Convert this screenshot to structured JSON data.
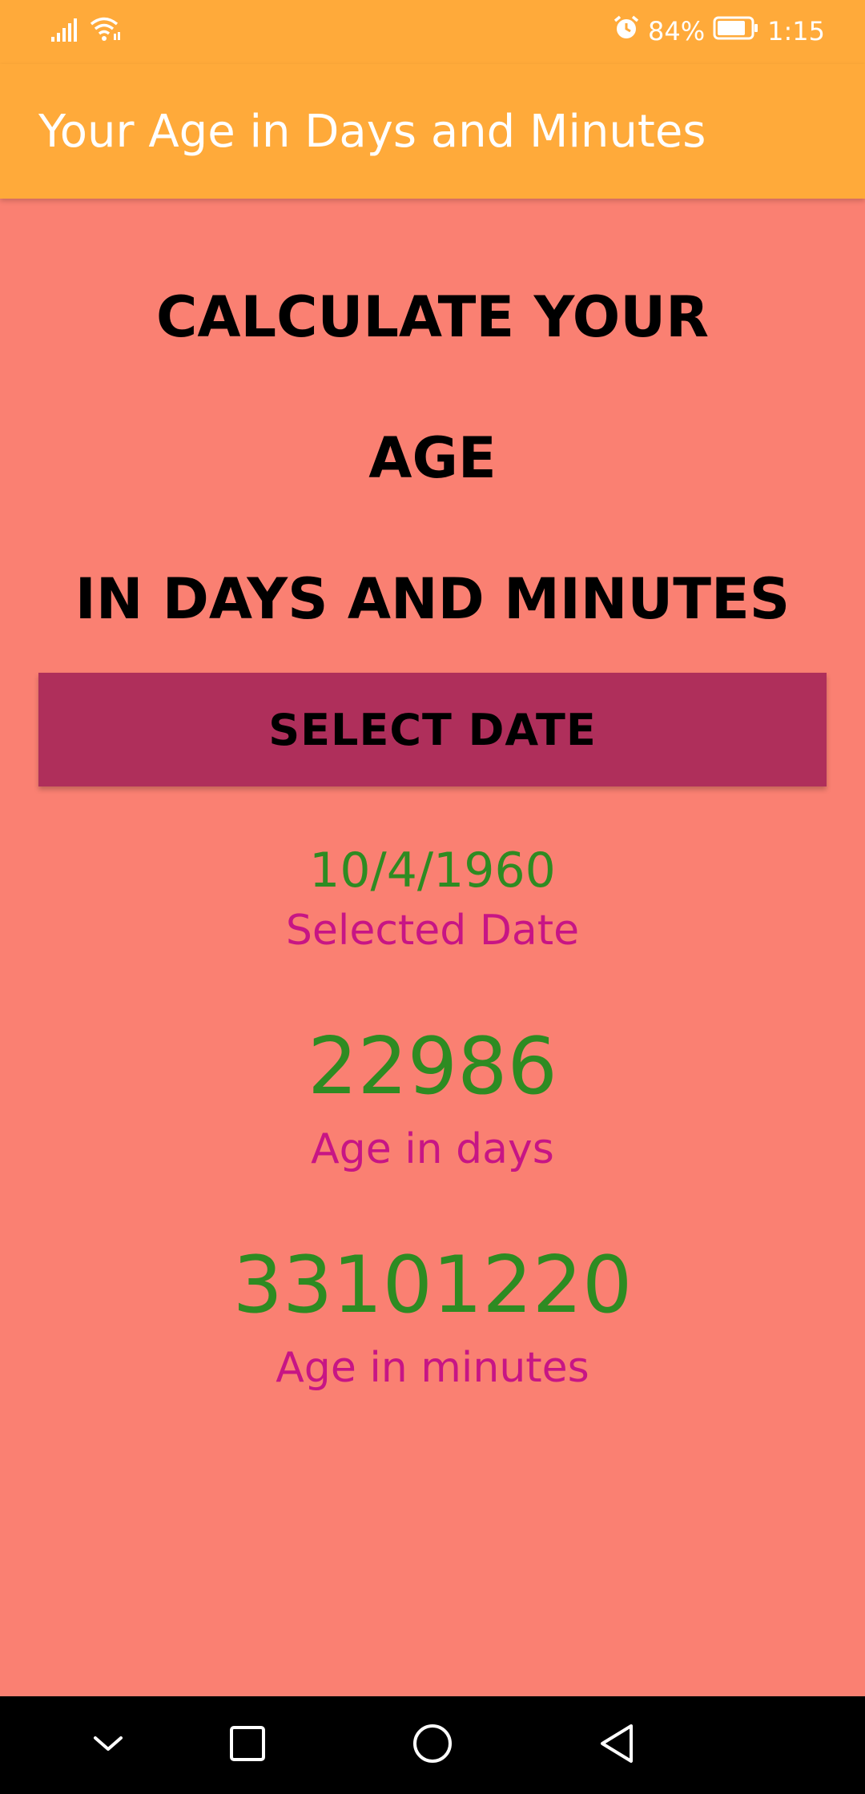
{
  "status_bar": {
    "battery": "84%",
    "time": "1:15",
    "icons": [
      "signal-icon",
      "wifi-icon",
      "alarm-icon",
      "battery-icon"
    ]
  },
  "app_bar": {
    "title": "Your Age in Days and Minutes"
  },
  "main": {
    "heading_line1": "CALCULATE YOUR",
    "heading_line2": "AGE",
    "heading_line3": "IN DAYS AND MINUTES",
    "select_button": "SELECT DATE",
    "selected_date_value": "10/4/1960",
    "selected_date_label": "Selected Date",
    "age_days_value": "22986",
    "age_days_label": "Age in days",
    "age_minutes_value": "33101220",
    "age_minutes_label": "Age in minutes"
  },
  "nav_bar": {
    "icons": [
      "chevron-down-icon",
      "recents-square-icon",
      "home-circle-icon",
      "back-triangle-icon"
    ]
  },
  "colors": {
    "app_bar": "#FFAA3A",
    "background": "#FA8072",
    "button": "#AF2F5B",
    "value_green": "#2E8B22",
    "label_magenta": "#C71585"
  }
}
